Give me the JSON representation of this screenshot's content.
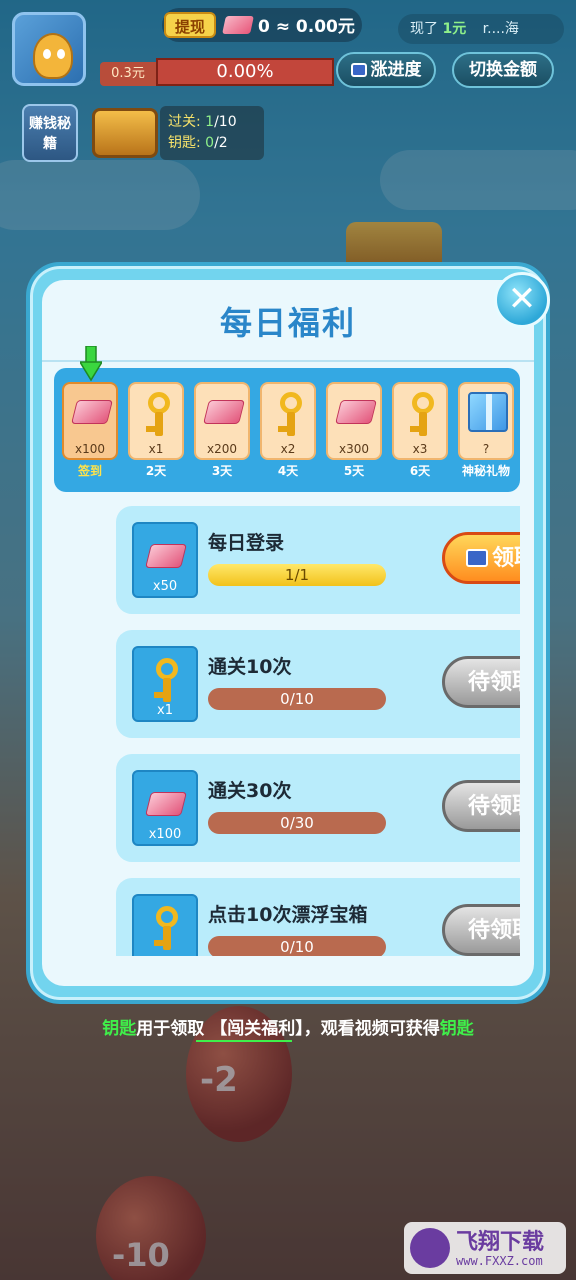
{
  "top": {
    "withdraw_label": "提现",
    "balance_text": "0 ≈ 0.00元",
    "notice_prefix": "现了",
    "notice_amount": "1元",
    "notice_suffix": "r....海",
    "progress_tag": "0.3元",
    "progress_text": "0.00%",
    "progress_value": 0,
    "speed_button": "涨进度",
    "switch_button": "切换金额",
    "secret_button": "赚钱秘籍",
    "stats": {
      "levels_label": "过关:",
      "levels_current": "1",
      "levels_total": "/10",
      "keys_label": "钥匙:",
      "keys_current": "0",
      "keys_total": "/2"
    }
  },
  "modal": {
    "title": "每日福利",
    "close_icon": "close-icon",
    "days": [
      {
        "icon": "cash-icon",
        "count": "x100",
        "label": "签到",
        "active": true
      },
      {
        "icon": "key-icon",
        "count": "x1",
        "label": "2天"
      },
      {
        "icon": "cash-icon",
        "count": "x200",
        "label": "3天"
      },
      {
        "icon": "key-icon",
        "count": "x2",
        "label": "4天"
      },
      {
        "icon": "cash-icon",
        "count": "x300",
        "label": "5天"
      },
      {
        "icon": "key-icon",
        "count": "x3",
        "label": "6天"
      },
      {
        "icon": "gift-icon",
        "count": "?",
        "label": "神秘礼物"
      }
    ],
    "tasks": [
      {
        "icon": "cash-icon",
        "qty": "x50",
        "title": "每日登录",
        "progress": "1/1",
        "button": "领取",
        "state": "claim"
      },
      {
        "icon": "key-icon",
        "qty": "x1",
        "title": "通关10次",
        "progress": "0/10",
        "button": "待领取",
        "state": "wait"
      },
      {
        "icon": "cash-icon",
        "qty": "x100",
        "title": "通关30次",
        "progress": "0/30",
        "button": "待领取",
        "state": "wait"
      },
      {
        "icon": "key-icon",
        "qty": "",
        "title": "点击10次漂浮宝箱",
        "progress": "0/10",
        "button": "待领取",
        "state": "wait"
      }
    ]
  },
  "footer": {
    "part1": "钥匙",
    "part2": "用于领取",
    "part3": "【闯关福利】",
    "part4": "，观看视频可获得",
    "part5": "钥匙"
  },
  "background": {
    "balloon_1": "-2",
    "balloon_2": "-10"
  },
  "watermark": {
    "text": "飞翔下载",
    "url": "www.FXXZ.com"
  },
  "colors": {
    "accent": "#2a86c9",
    "claim": "#ff8d1f",
    "highlight_green": "#3ff04a"
  }
}
